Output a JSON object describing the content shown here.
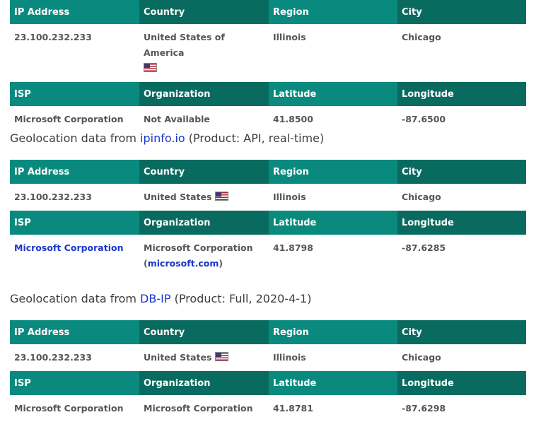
{
  "headers": {
    "ip": "IP Address",
    "country": "Country",
    "region": "Region",
    "city": "City",
    "isp": "ISP",
    "organization": "Organization",
    "latitude": "Latitude",
    "longitude": "Longitude"
  },
  "flag_icon": "us-flag-icon",
  "colors": {
    "header_a": "#0a8a7e",
    "header_b": "#096b60",
    "link": "#1a35c9"
  },
  "block1": {
    "ip": "23.100.232.233",
    "country": "United States of America",
    "region": "Illinois",
    "city": "Chicago",
    "isp": "Microsoft Corporation",
    "organization": "Not Available",
    "latitude": "41.8500",
    "longitude": "-87.6500"
  },
  "block2": {
    "heading_prefix": "Geolocation data from ",
    "source_link": "ipinfo.io",
    "heading_suffix": " (Product: API, real-time)",
    "ip": "23.100.232.233",
    "country": "United States",
    "region": "Illinois",
    "city": "Chicago",
    "isp": "Microsoft Corporation",
    "organization": "Microsoft Corporation",
    "org_paren_open": "(",
    "org_domain": "microsoft.com",
    "org_paren_close": ")",
    "latitude": "41.8798",
    "longitude": "-87.6285"
  },
  "block3": {
    "heading_prefix": "Geolocation data from ",
    "source_link": "DB-IP",
    "heading_suffix": " (Product: Full, 2020-4-1)",
    "ip": "23.100.232.233",
    "country": "United States",
    "region": "Illinois",
    "city": "Chicago",
    "isp": "Microsoft Corporation",
    "organization": "Microsoft Corporation",
    "latitude": "41.8781",
    "longitude": "-87.6298"
  }
}
